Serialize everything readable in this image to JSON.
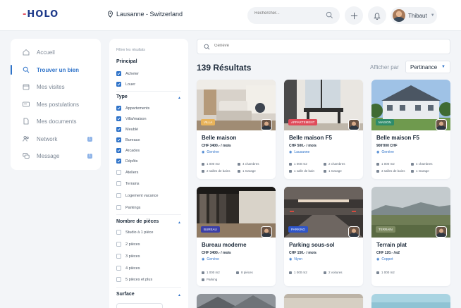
{
  "header": {
    "logo_text": "HOLO",
    "location": "Lausanne - Switzerland",
    "search_placeholder": "Rechercher...",
    "user_name": "Thibaut"
  },
  "sidebar": {
    "items": [
      {
        "label": "Accueil",
        "icon": "home-icon"
      },
      {
        "label": "Trouver un bien",
        "icon": "search-icon",
        "active": true
      },
      {
        "label": "Mes visites",
        "icon": "calendar-icon"
      },
      {
        "label": "Mes postulations",
        "icon": "card-icon"
      },
      {
        "label": "Mes documents",
        "icon": "document-icon"
      },
      {
        "label": "Network",
        "icon": "users-icon",
        "badge": "1"
      },
      {
        "label": "Message",
        "icon": "chat-icon",
        "badge": "1"
      }
    ]
  },
  "filters": {
    "caption": "Filtrer les résultats",
    "principal": {
      "title": "Principal",
      "options": [
        {
          "label": "Acheter",
          "checked": true
        },
        {
          "label": "Louer",
          "checked": true
        }
      ]
    },
    "type": {
      "title": "Type",
      "options": [
        {
          "label": "Appartements",
          "checked": true
        },
        {
          "label": "Villa/maison",
          "checked": true
        },
        {
          "label": "Meublé",
          "checked": true
        },
        {
          "label": "Bureaux",
          "checked": true
        },
        {
          "label": "Arcades",
          "checked": true
        },
        {
          "label": "Dépôts",
          "checked": true
        },
        {
          "label": "Ateliers",
          "checked": false
        },
        {
          "label": "Terrains",
          "checked": false
        },
        {
          "label": "Logement vacance",
          "checked": false
        },
        {
          "label": "Parkings",
          "checked": false
        }
      ]
    },
    "rooms": {
      "title": "Nombre de pièces",
      "options": [
        {
          "label": "Studio à 1 pièce",
          "checked": false
        },
        {
          "label": "2 pièces",
          "checked": false
        },
        {
          "label": "3 pièces",
          "checked": false
        },
        {
          "label": "4 pièces",
          "checked": false
        },
        {
          "label": "5 pièces et plus",
          "checked": false
        }
      ]
    },
    "surface": {
      "title": "Surface"
    }
  },
  "main": {
    "search_placeholder": "Genève",
    "results_title": "139 Résultats",
    "sort_label": "Afficher par",
    "sort_value": "Pertinance"
  },
  "cards": [
    {
      "title": "Belle maison",
      "price": "CHF 3400.- / mois",
      "location": "Genève",
      "tag": "Villa",
      "tag_color": "#e8b35a",
      "image": "interior-living-room",
      "features": [
        "1 000 m2",
        "4 chambres",
        "2 salles de bains",
        "1 Garage"
      ]
    },
    {
      "title": "Belle maison F5",
      "price": "CHF 500.- / mois",
      "location": "Lausanne",
      "tag": "Appartement",
      "tag_color": "#e04b5a",
      "image": "interior-dining-room",
      "features": [
        "1 000 m2",
        "2 chambres",
        "1 salle de bain",
        "1 Garage"
      ]
    },
    {
      "title": "Belle maison F5",
      "price": "900'000 CHF",
      "location": "Genève",
      "tag": "Maison",
      "tag_color": "#2e8c6a",
      "image": "house-exterior",
      "features": [
        "1 000 m2",
        "4 chambres",
        "3 salles de bains",
        "1 Garage"
      ]
    },
    {
      "title": "Bureau moderne",
      "price": "CHF 3400.- / mois",
      "location": "Genève",
      "tag": "Bureau",
      "tag_color": "#3b3fa8",
      "image": "office-interior",
      "features": [
        "1 000 m2",
        "8 pièces",
        "Parking"
      ]
    },
    {
      "title": "Parking sous-sol",
      "price": "CHF 150.- / mois",
      "location": "Nyon",
      "tag": "Parking",
      "tag_color": "#2f55c9",
      "image": "parking-garage",
      "features": [
        "1 000 m2",
        "2 voitures"
      ]
    },
    {
      "title": "Terrain plat",
      "price": "CHF 120.- /m2",
      "location": "Coppet",
      "tag": "Terrain",
      "tag_color": "#7d8a62",
      "image": "flat-land",
      "features": [
        "1 000 m2"
      ]
    }
  ]
}
